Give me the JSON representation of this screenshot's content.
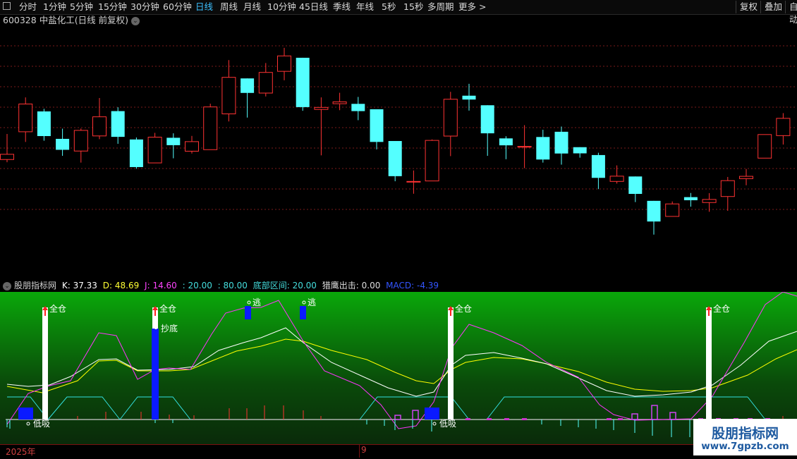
{
  "toolbar": {
    "periods": [
      "分时",
      "1分钟",
      "5分钟",
      "15分钟",
      "30分钟",
      "60分钟",
      "日线",
      "周线",
      "月线",
      "10分钟",
      "45日线",
      "季线",
      "年线",
      "5秒",
      "15秒",
      "多周期",
      "更多 >"
    ],
    "active": "日线",
    "right_buttons": [
      "复权",
      "叠加",
      "自动"
    ]
  },
  "stock": {
    "code": "600328",
    "name": "中盐化工",
    "mode": "(日线 前复权)"
  },
  "indicator": {
    "name": "股朋指标网",
    "k_label": "K: 37.33",
    "d_label": "D: 48.69",
    "j_label": "J: 14.60",
    "l20": ": 20.00",
    "l80": ": 80.00",
    "bottom_zone_label": "底部区间: 20.00",
    "eagle_label": "猎鹰出击: 0.00",
    "macd_label": "MACD: -4.39"
  },
  "signals": {
    "full": "全仓",
    "bottom": "抄底",
    "escape": "逃",
    "low_buy": "低吸"
  },
  "xaxis": {
    "year": "2025年",
    "month": "9"
  },
  "watermark": {
    "line1": "股朋指标网",
    "line2": "www.7gpzb.com"
  },
  "colors": {
    "up": "#ff3333",
    "down": "#54ffff",
    "k": "#ffffff",
    "d": "#ffff00",
    "j": "#ff33ff",
    "zone": "#33e0e0",
    "blue": "#0a1aff"
  },
  "chart_data": {
    "type": "candlestick",
    "candles": [
      {
        "o": 69.4,
        "c": 72.8,
        "h": 86.0,
        "l": 67.6,
        "dir": "up"
      },
      {
        "o": 87.4,
        "c": 105.4,
        "h": 109.7,
        "l": 80.8,
        "dir": "up"
      },
      {
        "o": 100.6,
        "c": 84.6,
        "h": 102.3,
        "l": 81.6,
        "dir": "down"
      },
      {
        "o": 82.8,
        "c": 75.7,
        "h": 89.4,
        "l": 71.8,
        "dir": "down"
      },
      {
        "o": 74.9,
        "c": 88.3,
        "h": 89.5,
        "l": 67.4,
        "dir": "up"
      },
      {
        "o": 84.7,
        "c": 97.1,
        "h": 109.3,
        "l": 82.6,
        "dir": "up"
      },
      {
        "o": 100.8,
        "c": 84.1,
        "h": 103.3,
        "l": 79.6,
        "dir": "down"
      },
      {
        "o": 82.4,
        "c": 64.5,
        "h": 83.7,
        "l": 63.4,
        "dir": "down"
      },
      {
        "o": 67.2,
        "c": 83.9,
        "h": 86.7,
        "l": 67.0,
        "dir": "up"
      },
      {
        "o": 83.5,
        "c": 78.7,
        "h": 86.4,
        "l": 70.2,
        "dir": "down"
      },
      {
        "o": 74.8,
        "c": 81.0,
        "h": 84.7,
        "l": 73.3,
        "dir": "up"
      },
      {
        "o": 75.8,
        "c": 103.5,
        "h": 105.6,
        "l": 75.8,
        "dir": "up"
      },
      {
        "o": 122.7,
        "c": 99.0,
        "h": 133.9,
        "l": 94.1,
        "dir": "up"
      },
      {
        "o": 122.0,
        "c": 112.6,
        "h": 122.0,
        "l": 96.6,
        "dir": "down"
      },
      {
        "o": 112.5,
        "c": 125.9,
        "h": 132.0,
        "l": 110.3,
        "dir": "up"
      },
      {
        "o": 126.6,
        "c": 136.6,
        "h": 141.8,
        "l": 120.8,
        "dir": "up"
      },
      {
        "o": 135.4,
        "c": 103.4,
        "h": 135.4,
        "l": 101.0,
        "dir": "down"
      },
      {
        "o": 103.2,
        "c": 101.9,
        "h": 109.7,
        "l": 72.1,
        "dir": "up"
      },
      {
        "o": 106.8,
        "c": 105.6,
        "h": 112.7,
        "l": 101.4,
        "dir": "up"
      },
      {
        "o": 105.5,
        "c": 100.8,
        "h": 110.0,
        "l": 94.9,
        "dir": "down"
      },
      {
        "o": 102.0,
        "c": 80.8,
        "h": 102.0,
        "l": 76.0,
        "dir": "down"
      },
      {
        "o": 81.4,
        "c": 58.6,
        "h": 81.4,
        "l": 55.3,
        "dir": "down"
      },
      {
        "o": 55.2,
        "c": 55.2,
        "h": 62.3,
        "l": 47.2,
        "dir": "up"
      },
      {
        "o": 55.5,
        "c": 81.8,
        "h": 82.4,
        "l": 55.5,
        "dir": "up"
      },
      {
        "o": 84.6,
        "c": 108.5,
        "h": 113.3,
        "l": 71.6,
        "dir": "up"
      },
      {
        "o": 110.8,
        "c": 108.3,
        "h": 118.5,
        "l": 101.1,
        "dir": "down"
      },
      {
        "o": 104.6,
        "c": 86.4,
        "h": 104.6,
        "l": 71.8,
        "dir": "down"
      },
      {
        "o": 83.1,
        "c": 78.6,
        "h": 84.5,
        "l": 69.6,
        "dir": "down"
      },
      {
        "o": 77.9,
        "c": 77.9,
        "h": 91.7,
        "l": 63.8,
        "dir": "up"
      },
      {
        "o": 84.0,
        "c": 69.4,
        "h": 88.7,
        "l": 67.4,
        "dir": "down"
      },
      {
        "o": 87.4,
        "c": 73.3,
        "h": 90.8,
        "l": 66.1,
        "dir": "down"
      },
      {
        "o": 77.4,
        "c": 73.4,
        "h": 77.4,
        "l": 70.6,
        "dir": "down"
      },
      {
        "o": 72.3,
        "c": 57.5,
        "h": 73.8,
        "l": 50.2,
        "dir": "down"
      },
      {
        "o": 55.2,
        "c": 58.6,
        "h": 65.6,
        "l": 53.8,
        "dir": "up"
      },
      {
        "o": 58.4,
        "c": 47.1,
        "h": 58.4,
        "l": 41.8,
        "dir": "down"
      },
      {
        "o": 42.6,
        "c": 29.2,
        "h": 42.6,
        "l": 20.7,
        "dir": "down"
      },
      {
        "o": 32.5,
        "c": 40.6,
        "h": 42.2,
        "l": 32.5,
        "dir": "up"
      },
      {
        "o": 43.0,
        "c": 45.0,
        "h": 47.7,
        "l": 38.8,
        "dir": "down"
      },
      {
        "o": 41.5,
        "c": 43.5,
        "h": 47.6,
        "l": 35.5,
        "dir": "up"
      },
      {
        "o": 45.4,
        "c": 55.7,
        "h": 58.1,
        "l": 36.1,
        "dir": "up"
      },
      {
        "o": 57.0,
        "c": 58.5,
        "h": 63.3,
        "l": 52.7,
        "dir": "up"
      },
      {
        "o": 70.3,
        "c": 85.6,
        "h": 85.6,
        "l": 70.3,
        "dir": "up"
      },
      {
        "o": 84.9,
        "c": 96.1,
        "h": 99.5,
        "l": 79.1,
        "dir": "up"
      }
    ]
  }
}
